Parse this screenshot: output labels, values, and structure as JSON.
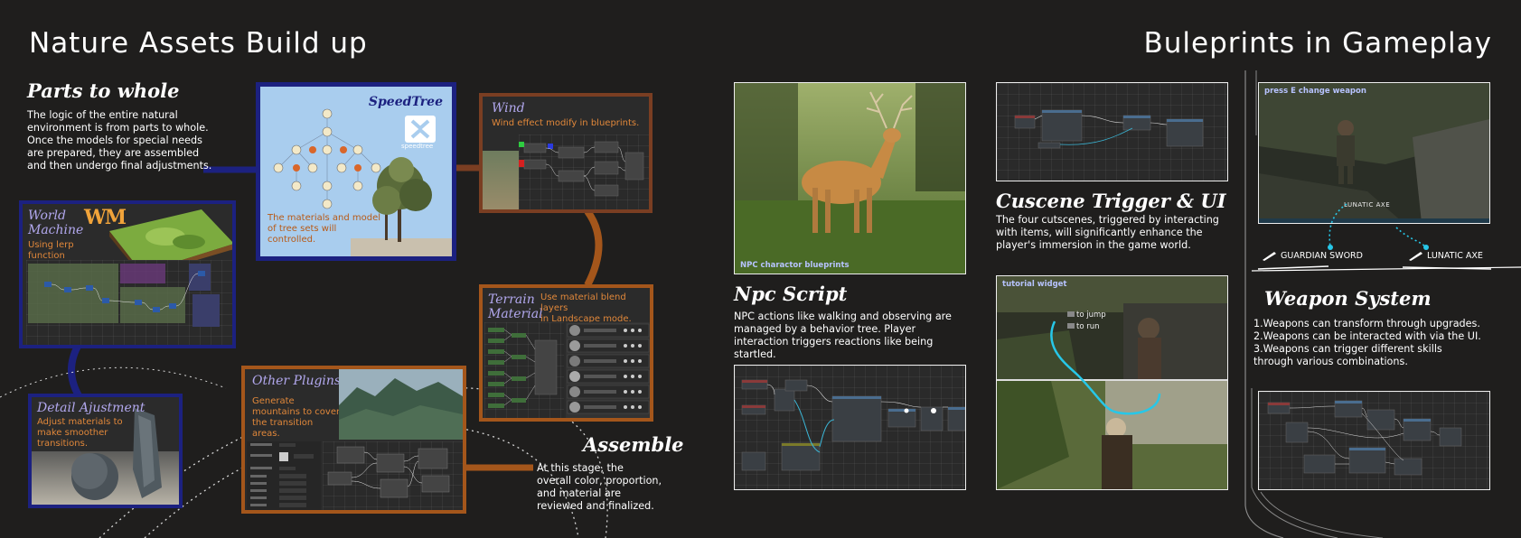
{
  "left": {
    "title": "Nature Assets Build up",
    "parts_to_whole": {
      "heading": "Parts to whole",
      "text": "The logic of the entire natural\nenvironment is from parts to whole.\nOnce the models for special needs\nare prepared, they are assembled\nand then undergo final adjustments."
    },
    "speedtree": {
      "title": "SpeedTree",
      "logo_text": "speedtree",
      "caption": "The materials and model\nof tree sets will\ncontrolled."
    },
    "wind": {
      "title": "Wind",
      "caption": "Wind effect modify in blueprints."
    },
    "world_machine": {
      "title_line1": "World",
      "title_line2": "Machine",
      "logo": "WM",
      "caption": "Using lerp\nfunction\ncontrol hills."
    },
    "terrain_material": {
      "title_line1": "Terrain",
      "title_line2": "Material",
      "caption": "Use material blend layers\nin Landscape mode."
    },
    "detail_adjustment": {
      "title": "Detail Ajustment",
      "caption": "Adjust materials to\nmake smoother\ntransitions."
    },
    "other_plugins": {
      "title": "Other Plugins",
      "caption": "Generate\nmountains to cover\nthe transition\nareas."
    },
    "assemble": {
      "heading": "Assemble",
      "text": "At this stage, the\noverall color, proportion,\nand material are\nreviewed and finalized."
    }
  },
  "right": {
    "title": "Buleprints in Gameplay",
    "npc": {
      "image_label": "NPC charactor blueprints",
      "heading": "Npc Script",
      "text": "NPC actions like walking and observing are\nmanaged by a behavior tree. Player\ninteraction triggers reactions like being\nstartled."
    },
    "cutscene": {
      "heading": "Cuscene Trigger & UI",
      "text": "The four cutscenes, triggered by interacting\nwith items, will significantly enhance the\nplayer's immersion in the game world.",
      "widget_label": "tutorial widget",
      "hint_jump": "to jump",
      "hint_run": "to run"
    },
    "weapon": {
      "image_label": "press E change weapon",
      "hud_label": "LUNATIC  AXE",
      "weapon_a": "GUARDIAN SWORD",
      "weapon_b": "LUNATIC   AXE",
      "heading": "Weapon System",
      "text": "1.Weapons can transform through upgrades.\n2.Weapons can be interacted with via the UI.\n3.Weapons can trigger different skills\nthrough various combinations."
    }
  },
  "colors": {
    "background": "#1f1e1d",
    "navy_frame": "#1c2180",
    "brown_frame": "#7a3e22",
    "orange_frame": "#a4561b",
    "orange_text": "#e0873a",
    "purple_text": "#b2a8ee"
  }
}
